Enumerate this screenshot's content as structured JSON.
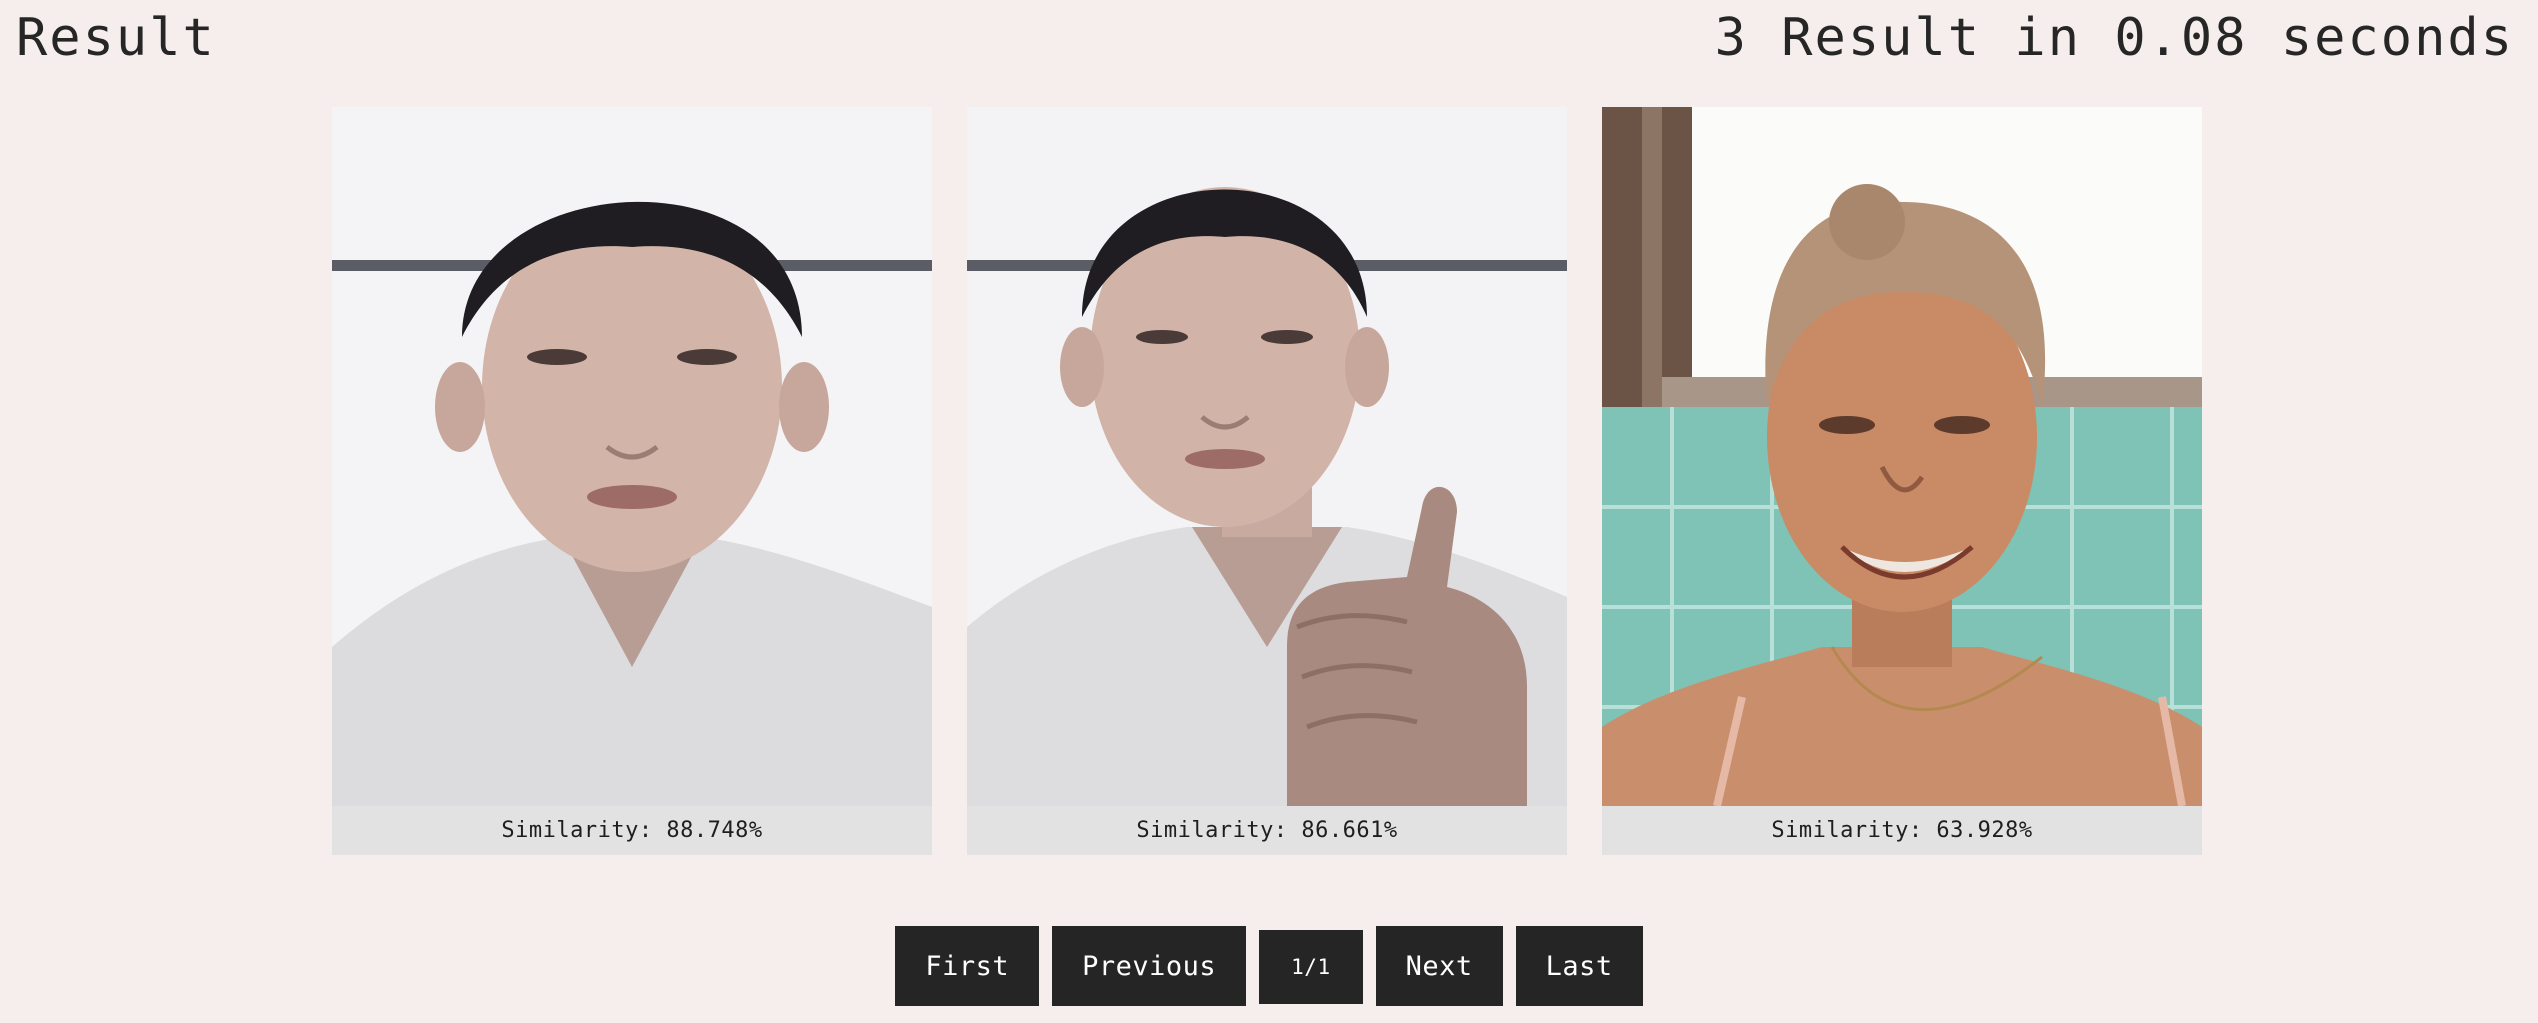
{
  "header": {
    "title": "Result",
    "summary": "3 Result in 0.08 seconds"
  },
  "results": [
    {
      "similarity_label": "Similarity: 88.748%",
      "similarity": 88.748
    },
    {
      "similarity_label": "Similarity: 86.661%",
      "similarity": 86.661
    },
    {
      "similarity_label": "Similarity: 63.928%",
      "similarity": 63.928
    }
  ],
  "pagination": {
    "first": "First",
    "previous": "Previous",
    "indicator": "1/1",
    "next": "Next",
    "last": "Last"
  },
  "colors": {
    "background": "#f6eeec",
    "button": "#252525",
    "caption_bg": "#e2e2e2"
  }
}
